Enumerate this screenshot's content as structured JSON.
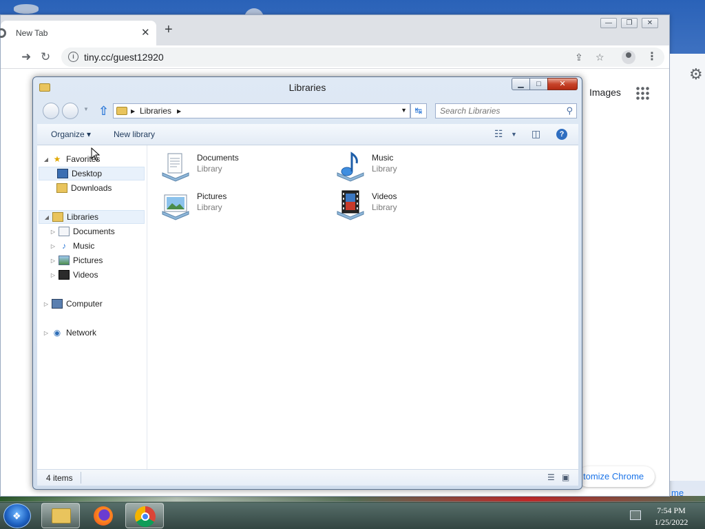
{
  "chrome": {
    "tab_title": "New Tab",
    "tab_close": "✕",
    "new_tab": "+",
    "url": "tiny.cc/guest12920",
    "images_link": "Images",
    "customize": "tomize Chrome",
    "partial_link": "me",
    "window_controls": [
      "—",
      "❐",
      "✕"
    ]
  },
  "explorer": {
    "title": "Libraries",
    "breadcrumb": [
      "Libraries"
    ],
    "search_placeholder": "Search Libraries",
    "commands": {
      "organize": "Organize ▾",
      "new_library": "New library"
    },
    "nav": {
      "favorites": "Favorites",
      "favorites_items": [
        "Desktop",
        "Downloads"
      ],
      "libraries": "Libraries",
      "libraries_items": [
        "Documents",
        "Music",
        "Pictures",
        "Videos"
      ],
      "computer": "Computer",
      "network": "Network"
    },
    "libraries": [
      {
        "name": "Documents",
        "type": "Library",
        "icon": "documents-library-icon"
      },
      {
        "name": "Music",
        "type": "Library",
        "icon": "music-library-icon"
      },
      {
        "name": "Pictures",
        "type": "Library",
        "icon": "pictures-library-icon"
      },
      {
        "name": "Videos",
        "type": "Library",
        "icon": "videos-library-icon"
      }
    ],
    "status": "4 items"
  },
  "taskbar": {
    "time": "7:54 PM",
    "date": "1/25/2022",
    "pinned": [
      "windows-explorer-icon",
      "firefox-icon",
      "chrome-icon"
    ]
  },
  "colors": {
    "accent": "#1a73e8",
    "explorer_frame": "#cfdcec",
    "close_red": "#c7442a"
  }
}
